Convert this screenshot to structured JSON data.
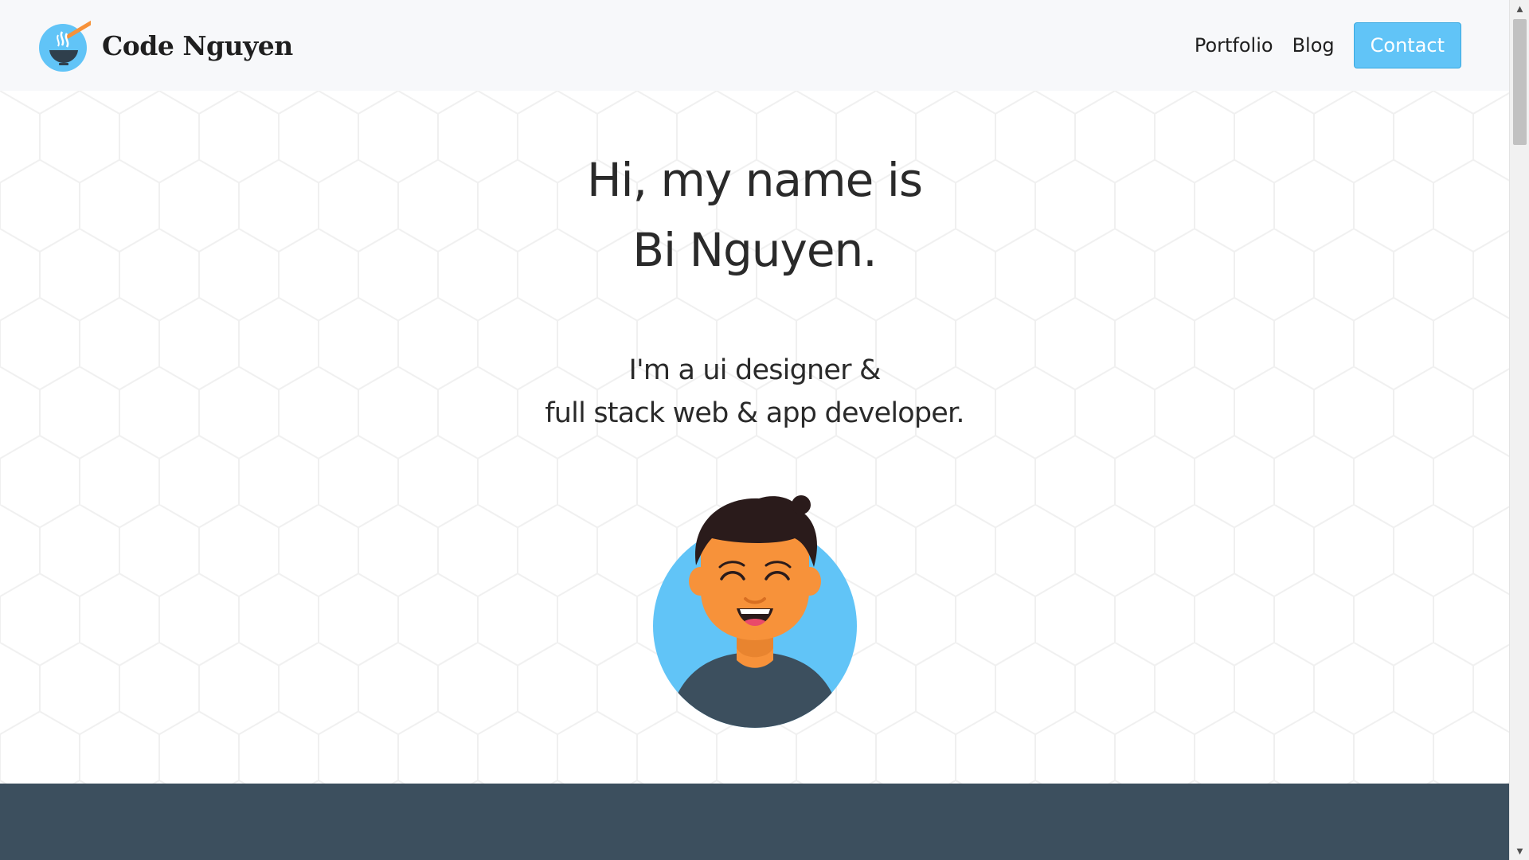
{
  "header": {
    "brand_name": "Code Nguyen",
    "nav": {
      "portfolio_label": "Portfolio",
      "blog_label": "Blog",
      "contact_label": "Contact"
    }
  },
  "hero": {
    "greeting_line1": "Hi, my name is",
    "greeting_line2": "Bi Nguyen.",
    "tagline_line1": "I'm a ui designer &",
    "tagline_line2": "full stack web & app developer."
  },
  "colors": {
    "accent": "#61c4f7",
    "header_bg": "#f7f8fa",
    "dark_band": "#3c4f5e",
    "text": "#2a2a2a",
    "skin": "#f7923a",
    "shirt": "#3c4f5e",
    "hair": "#2a1b1b"
  },
  "icons": {
    "logo": "noodle-bowl-chopsticks-icon",
    "scroll_up": "scroll-up-arrow-icon",
    "scroll_down": "scroll-down-arrow-icon"
  }
}
